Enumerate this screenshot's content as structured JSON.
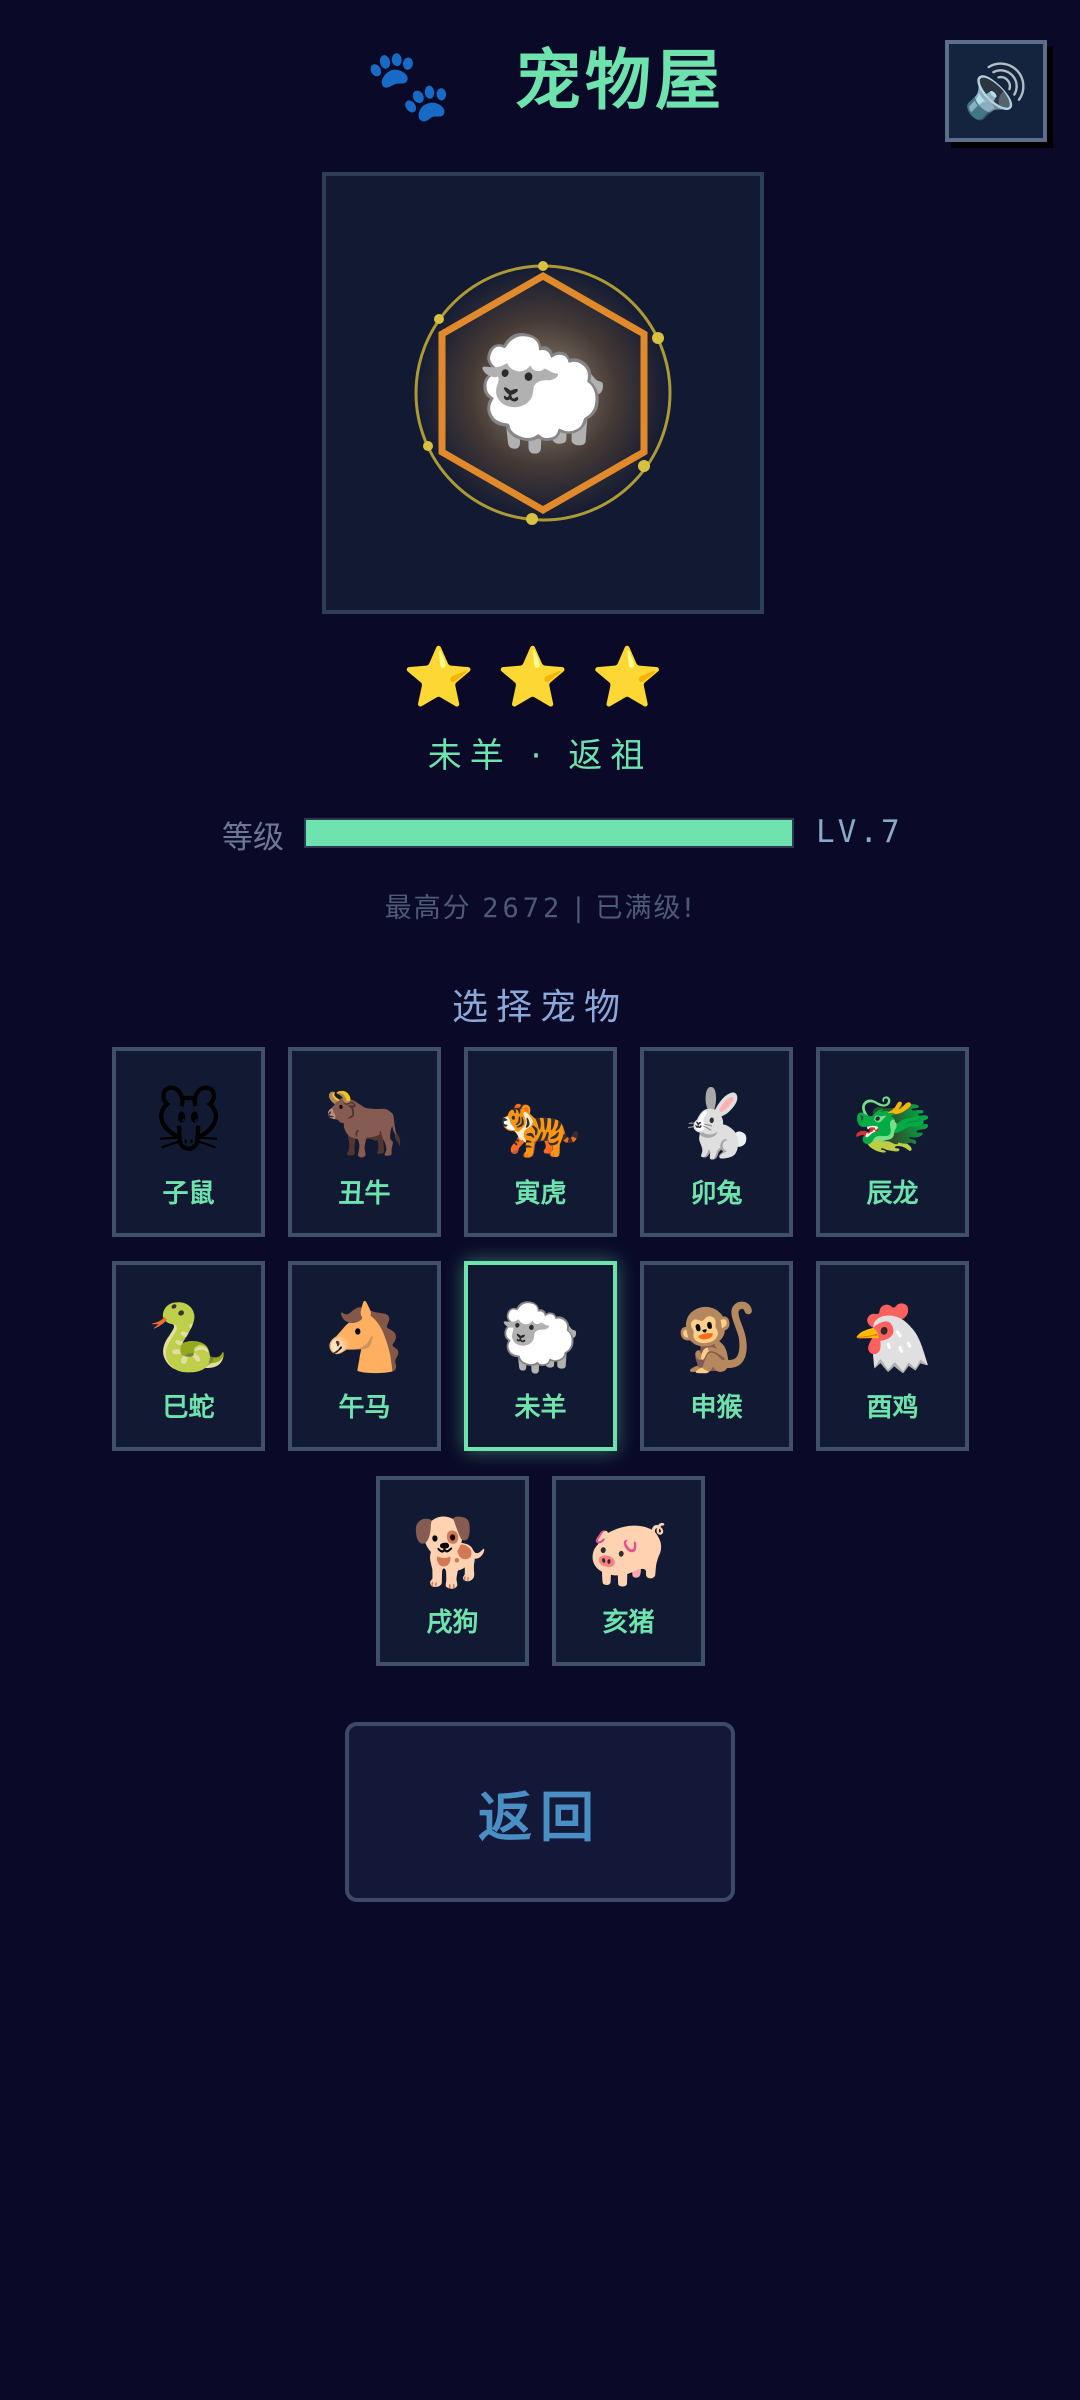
{
  "header": {
    "icon": "paw-icon",
    "title": "宠物屋",
    "sound_icon": "speaker-icon"
  },
  "display": {
    "pet_emoji": "🐑",
    "frame_color": "#e08a2c",
    "ring_color": "#c8b036"
  },
  "rating": {
    "stars": [
      "⭐",
      "⭐",
      "⭐"
    ],
    "count": 3
  },
  "pet_title": "未羊 · 返祖",
  "level": {
    "label": "等级",
    "progress": 1.0,
    "text": "LV.7",
    "bar_color": "#6ee3ad"
  },
  "high_score": {
    "prefix": "最高分",
    "score": "2672",
    "separator": "|",
    "status": "已满级!"
  },
  "select_title": "选择宠物",
  "pets": [
    {
      "emoji": "🐭",
      "name": "子鼠"
    },
    {
      "emoji": "🐂",
      "name": "丑牛"
    },
    {
      "emoji": "🐅",
      "name": "寅虎"
    },
    {
      "emoji": "🐇",
      "name": "卯兔"
    },
    {
      "emoji": "🐲",
      "name": "辰龙"
    },
    {
      "emoji": "🐍",
      "name": "巳蛇"
    },
    {
      "emoji": "🐴",
      "name": "午马"
    },
    {
      "emoji": "🐑",
      "name": "未羊",
      "selected": true
    },
    {
      "emoji": "🐒",
      "name": "申猴"
    },
    {
      "emoji": "🐔",
      "name": "酉鸡"
    },
    {
      "emoji": "🐕",
      "name": "戌狗"
    },
    {
      "emoji": "🐖",
      "name": "亥猪"
    }
  ],
  "back_button": "返回"
}
